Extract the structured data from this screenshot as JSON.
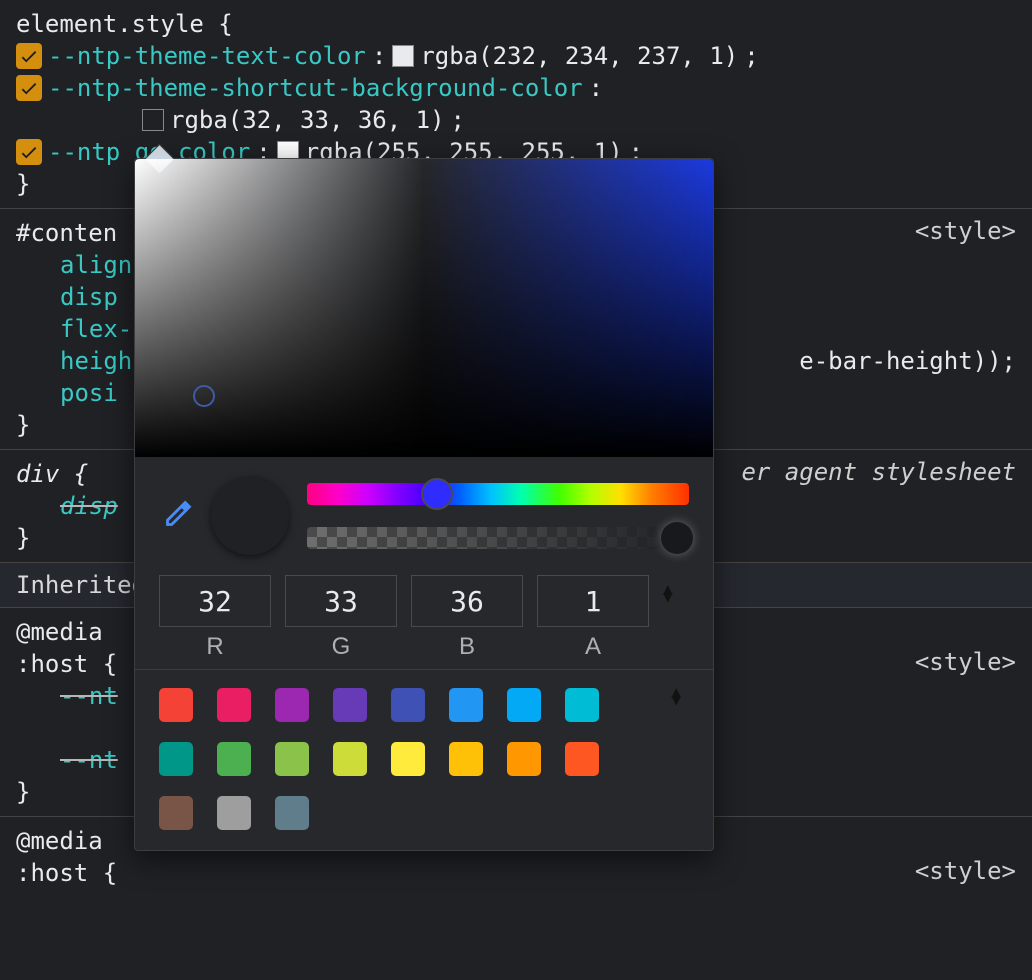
{
  "styles": {
    "elementStyle": {
      "selector": "element.style {",
      "close": "}",
      "props": [
        {
          "name": "--ntp-theme-text-color",
          "swatch": "#e8eaed",
          "value": "rgba(232, 234, 237, 1)"
        },
        {
          "name": "--ntp-theme-shortcut-background-color",
          "swatch": "#202124",
          "value": "rgba(32, 33, 36, 1)"
        },
        {
          "name": "--ntp   go color",
          "swatch": "#ffffff",
          "value": "rgba(255, 255, 255, 1)"
        }
      ]
    },
    "content": {
      "selector": "#conten",
      "source": "<style>",
      "props": [
        {
          "name": "align"
        },
        {
          "name": "disp"
        },
        {
          "name": "flex-"
        },
        {
          "name": "heigh",
          "tail": "e-bar-height));"
        },
        {
          "name": "posi"
        }
      ],
      "close": "}"
    },
    "div": {
      "selector": "div {",
      "source": "er agent stylesheet",
      "prop": "disp",
      "close": "}"
    },
    "inheritedLabel": "Inherited",
    "media1": {
      "media": "@media",
      "host": ":host {",
      "source": "<style>",
      "p1": "--nt",
      "p2": "--nt",
      "close": "}"
    },
    "media2": {
      "media": "@media",
      "host": ":host {",
      "source": "<style>"
    }
  },
  "picker": {
    "r": "32",
    "g": "33",
    "b": "36",
    "a": "1",
    "labels": {
      "r": "R",
      "g": "G",
      "b": "B",
      "a": "A"
    },
    "palettes": [
      [
        "#f44336",
        "#e91e63",
        "#9c27b0",
        "#673ab7",
        "#3f51b5",
        "#2196f3",
        "#03a9f4",
        "#00bcd4"
      ],
      [
        "#009688",
        "#4caf50",
        "#8bc34a",
        "#cddc39",
        "#ffeb3b",
        "#ffc107",
        "#ff9800",
        "#ff5722"
      ],
      [
        "#795548",
        "#9e9e9e",
        "#607d8b"
      ]
    ]
  }
}
